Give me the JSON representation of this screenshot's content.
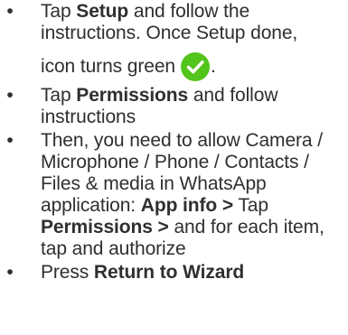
{
  "instructions": {
    "bullet": "•",
    "step1": {
      "pre": "Tap ",
      "bold": "Setup",
      "post": " and follow the instructions. Once Setup done,",
      "line3_text": "icon turns green",
      "line3_suffix": ".",
      "icon": "green-check-circle-icon",
      "icon_color": "#52c41a"
    },
    "step2": {
      "pre": "Tap ",
      "bold": "Permissions",
      "post": " and follow instructions"
    },
    "step3": {
      "pre": "Then, you need to allow Camera / Microphone / Phone / Contacts / Files & media in WhatsApp application: ",
      "bold1": "App info >",
      "mid": " Tap ",
      "bold2": "Permissions >",
      "post": " and for each item, tap and authorize"
    },
    "step4": {
      "pre": "Press ",
      "bold": "Return to Wizard"
    }
  }
}
